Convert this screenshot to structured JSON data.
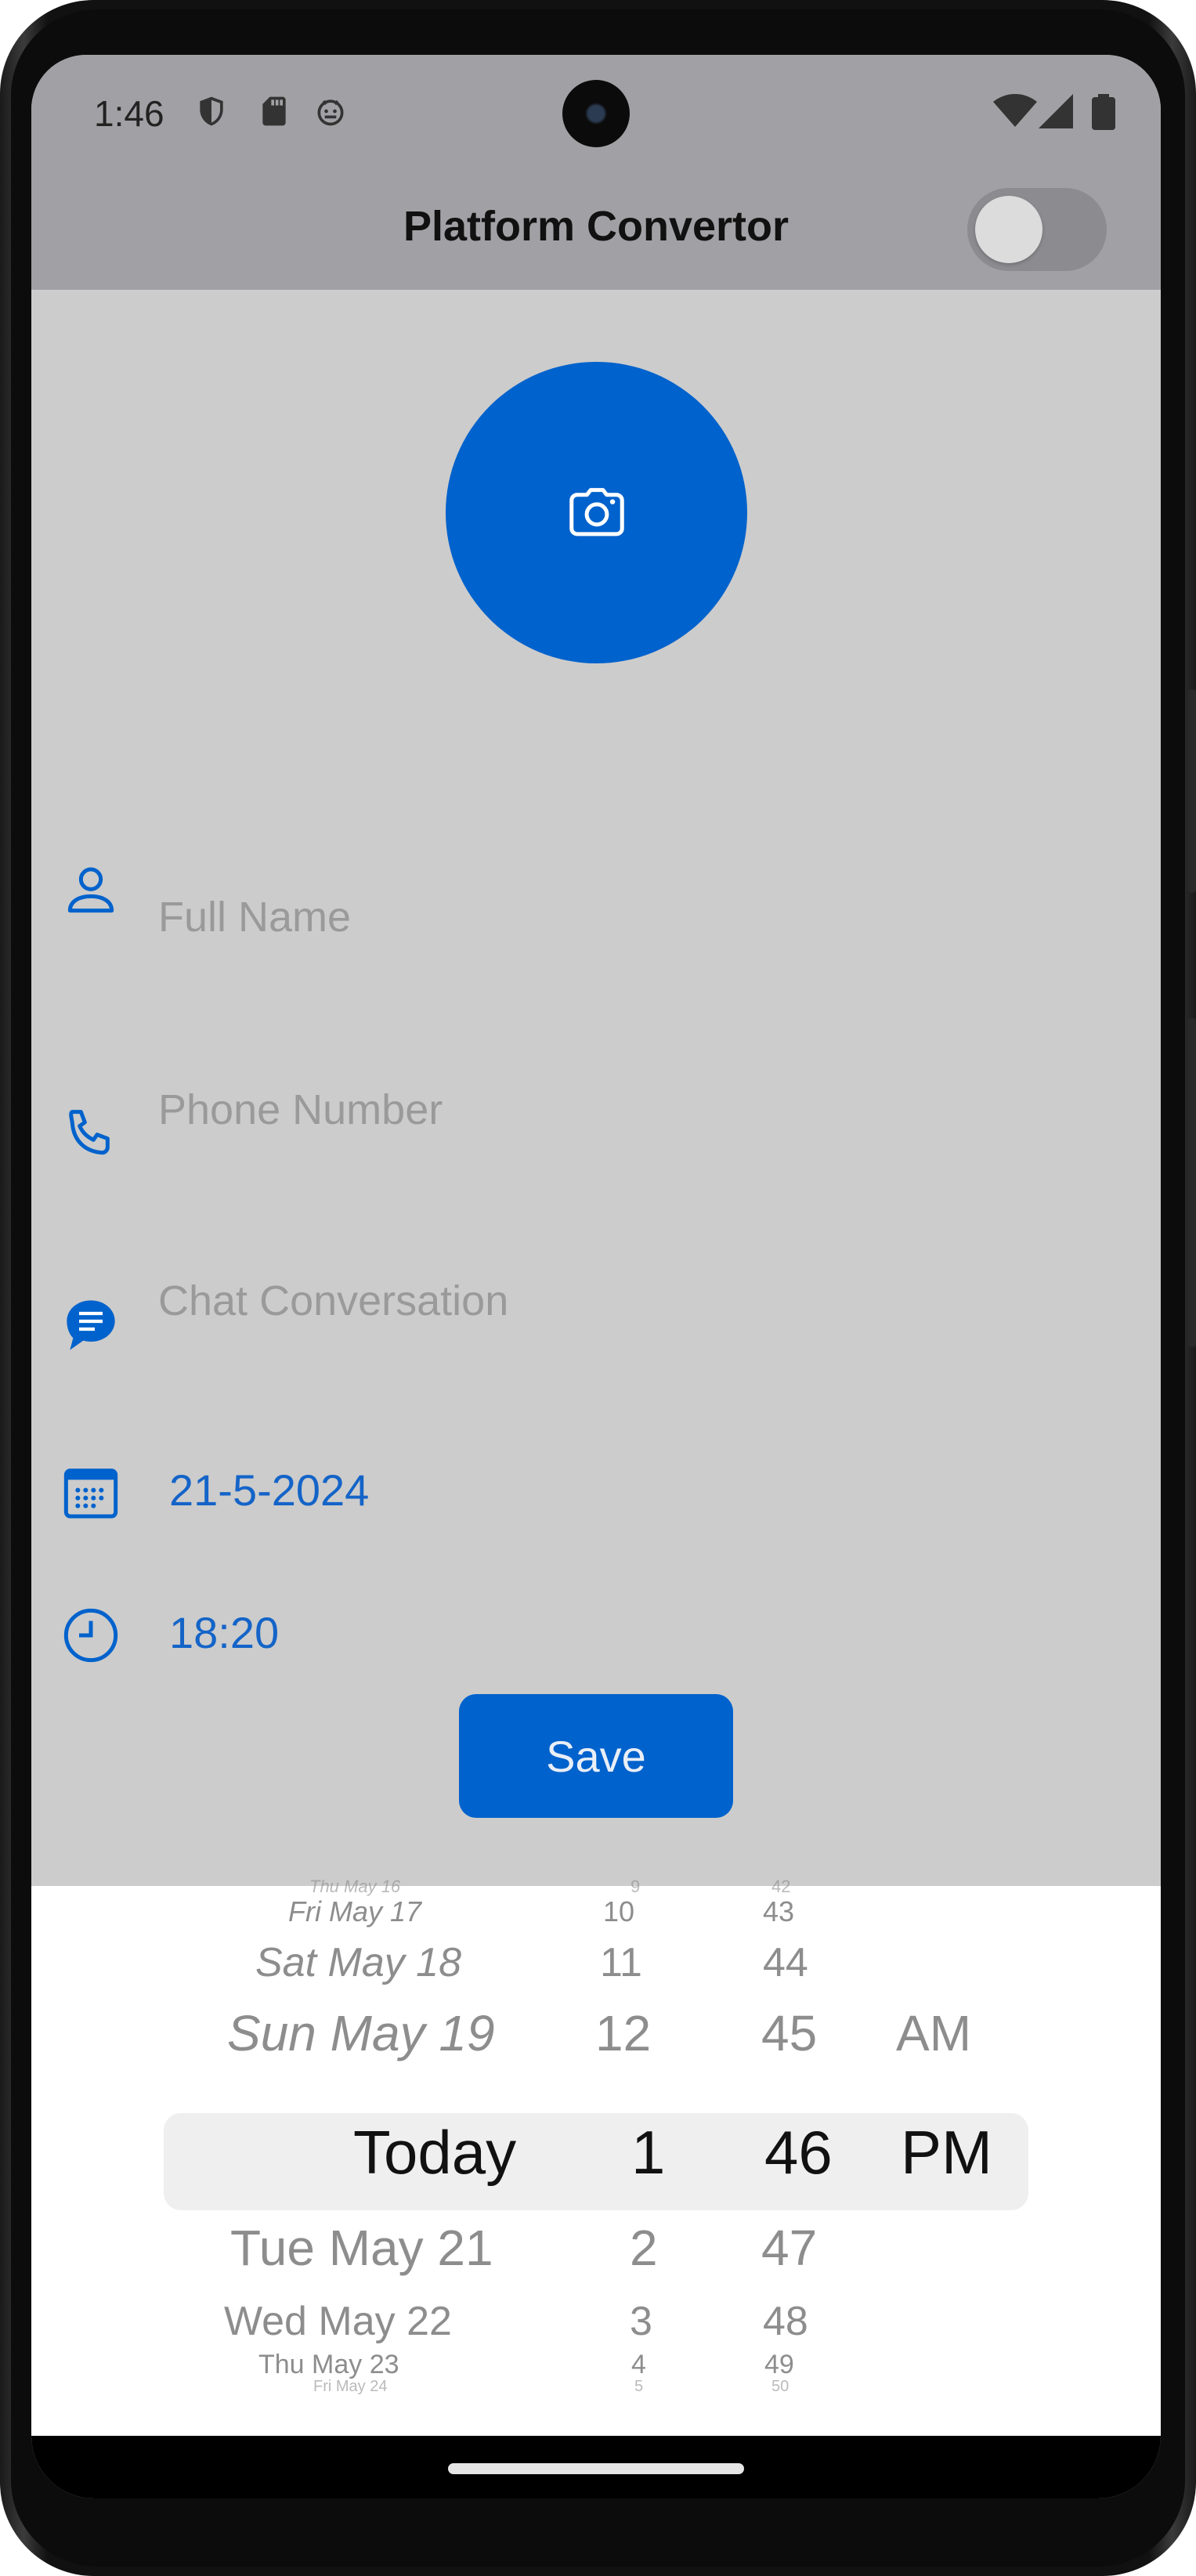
{
  "status_bar": {
    "time": "1:46",
    "icons": [
      "shield-icon",
      "sd-card-icon",
      "android-debug-icon",
      "wifi-icon",
      "signal-icon",
      "battery-icon"
    ]
  },
  "app_bar": {
    "title": "Platform Convertor",
    "switch_on": false
  },
  "form": {
    "photo_icon": "camera-icon",
    "full_name_placeholder": "Full Name",
    "phone_placeholder": "Phone Number",
    "chat_placeholder": "Chat Conversation",
    "date_value": "21-5-2024",
    "time_value": "18:20",
    "save_label": "Save"
  },
  "picker": {
    "day_column": [
      "Thu May 16",
      "Fri May 17",
      "Sat May 18",
      "Sun May 19",
      "Today",
      "Tue May 21",
      "Wed May 22",
      "Thu May 23",
      "Fri May 24"
    ],
    "hour_column": [
      "9",
      "10",
      "11",
      "12",
      "1",
      "2",
      "3",
      "4",
      "5"
    ],
    "minute_column": [
      "42",
      "43",
      "44",
      "45",
      "46",
      "47",
      "48",
      "49",
      "50"
    ],
    "ampm_column": [
      "AM",
      "PM"
    ],
    "selected": {
      "day": "Today",
      "hour": "1",
      "minute": "46",
      "ampm": "PM"
    }
  },
  "colors": {
    "accent": "#0062cc",
    "link_text": "#1464c8",
    "scrim_background": "#cccccc",
    "appbar_dimmed": "#a1a1a5"
  }
}
